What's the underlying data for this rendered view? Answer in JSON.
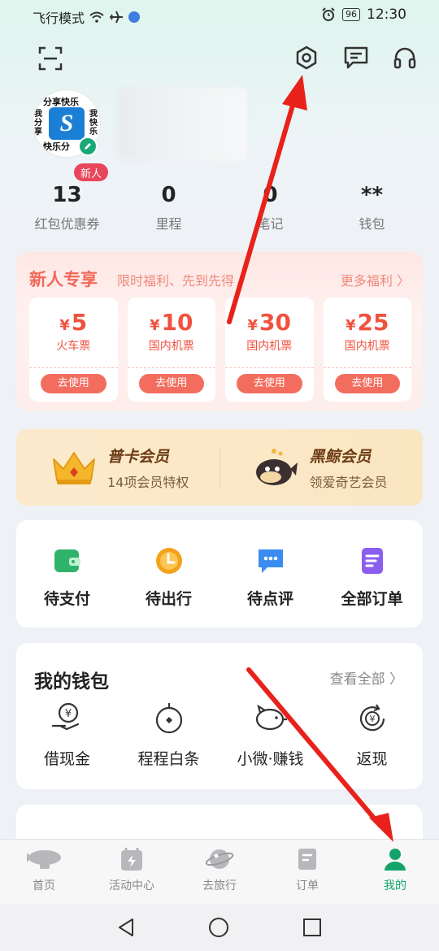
{
  "status": {
    "mode": "飞行模式",
    "battery": "96",
    "time": "12:30"
  },
  "profile": {
    "new_badge": "新人",
    "avatar_words": {
      "top": "分享快乐",
      "left": "我分享",
      "right": "我快乐",
      "bottom": "快乐分",
      "logo": "S"
    }
  },
  "stats": [
    {
      "value": "13",
      "label": "红包优惠券"
    },
    {
      "value": "0",
      "label": "里程"
    },
    {
      "value": "0",
      "label": "笔记"
    },
    {
      "value": "**",
      "label": "钱包"
    }
  ],
  "newuser": {
    "title": "新人专享",
    "subtitle": "限时福利、先到先得",
    "more": "更多福利 〉",
    "coupons": [
      {
        "amount": "5",
        "kind": "火车票",
        "action": "去使用"
      },
      {
        "amount": "10",
        "kind": "国内机票",
        "action": "去使用"
      },
      {
        "amount": "30",
        "kind": "国内机票",
        "action": "去使用"
      },
      {
        "amount": "25",
        "kind": "国内机票",
        "action": "去使用"
      }
    ],
    "currency": "¥"
  },
  "membership": [
    {
      "title": "普卡会员",
      "subtitle": "14项会员特权"
    },
    {
      "title": "黑鲸会员",
      "subtitle": "领爱奇艺会员"
    }
  ],
  "orders": [
    {
      "label": "待支付",
      "color": "#2fb36a"
    },
    {
      "label": "待出行",
      "color": "#f3a21c"
    },
    {
      "label": "待点评",
      "color": "#3a8cf0"
    },
    {
      "label": "全部订单",
      "color": "#8c5ef0"
    }
  ],
  "wallet": {
    "title": "我的钱包",
    "more": "查看全部 〉",
    "items": [
      {
        "label": "借现金",
        "icon": "hand-yen-icon"
      },
      {
        "label": "程程白条",
        "icon": "stopwatch-icon"
      },
      {
        "label": "小微·赚钱",
        "icon": "piggy-bank-icon"
      },
      {
        "label": "返现",
        "icon": "cashback-icon"
      }
    ]
  },
  "tabs": [
    {
      "label": "首页",
      "icon": "airship-icon"
    },
    {
      "label": "活动中心",
      "icon": "activity-icon"
    },
    {
      "label": "去旅行",
      "icon": "planet-icon"
    },
    {
      "label": "订单",
      "icon": "order-icon"
    },
    {
      "label": "我的",
      "icon": "user-icon",
      "active": true
    }
  ],
  "colors": {
    "accent": "#14a46a",
    "coupon": "#f0523f",
    "arrow": "#e8221b"
  }
}
